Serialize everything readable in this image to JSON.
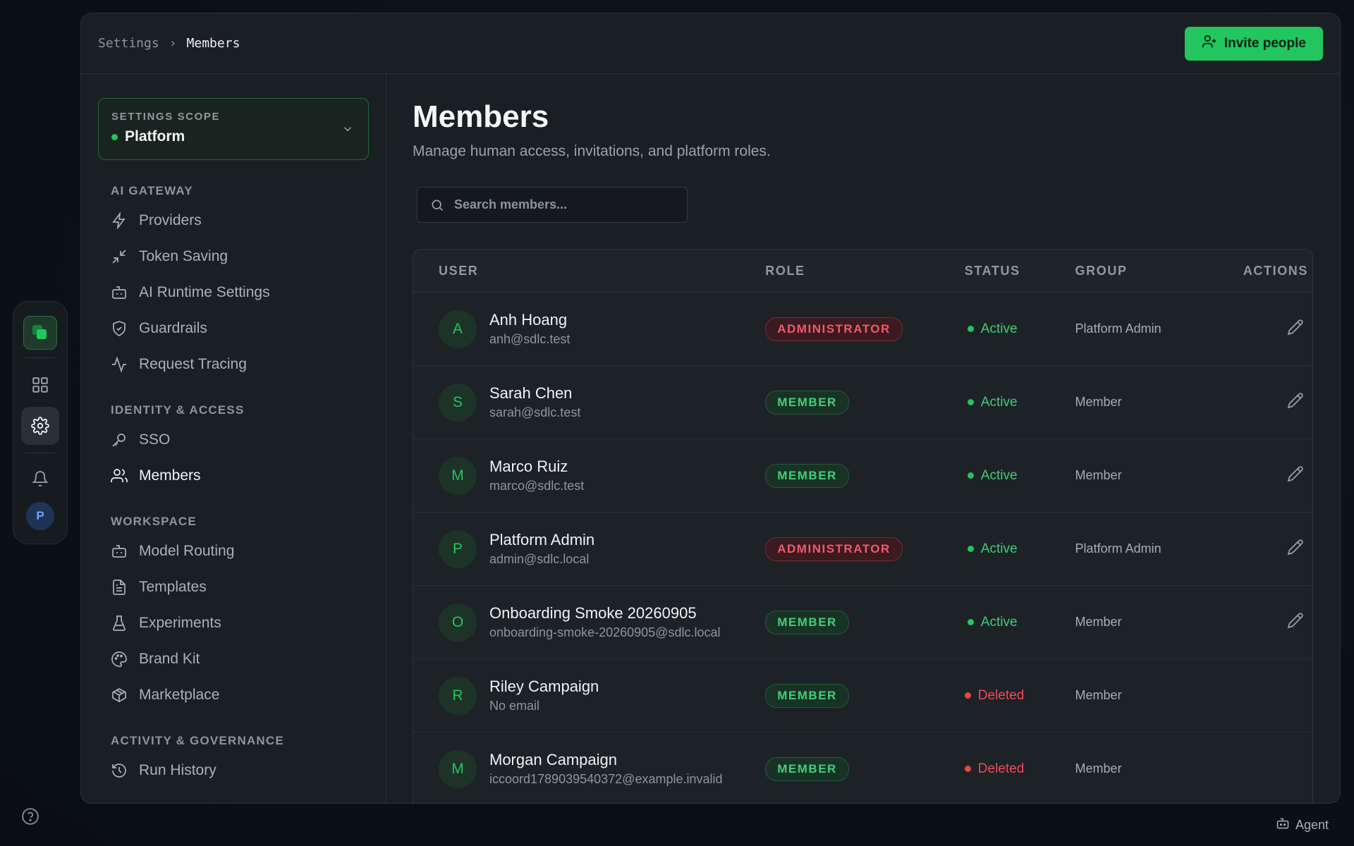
{
  "breadcrumb": {
    "parent": "Settings",
    "separator": "›",
    "current": "Members"
  },
  "header": {
    "invite_label": "Invite people"
  },
  "scope": {
    "label": "SETTINGS SCOPE",
    "value": "Platform"
  },
  "nav": {
    "ai_gateway": {
      "title": "AI GATEWAY",
      "items": [
        {
          "label": "Providers",
          "icon": "zap-icon"
        },
        {
          "label": "Token Saving",
          "icon": "minimize-icon"
        },
        {
          "label": "AI Runtime Settings",
          "icon": "bot-icon"
        },
        {
          "label": "Guardrails",
          "icon": "shield-icon"
        },
        {
          "label": "Request Tracing",
          "icon": "activity-icon"
        }
      ]
    },
    "identity": {
      "title": "IDENTITY & ACCESS",
      "items": [
        {
          "label": "SSO",
          "icon": "key-icon"
        },
        {
          "label": "Members",
          "icon": "users-icon"
        }
      ]
    },
    "workspace": {
      "title": "WORKSPACE",
      "items": [
        {
          "label": "Model Routing",
          "icon": "bot-icon"
        },
        {
          "label": "Templates",
          "icon": "file-icon"
        },
        {
          "label": "Experiments",
          "icon": "flask-icon"
        },
        {
          "label": "Brand Kit",
          "icon": "palette-icon"
        },
        {
          "label": "Marketplace",
          "icon": "package-icon"
        }
      ]
    },
    "activity": {
      "title": "ACTIVITY & GOVERNANCE",
      "items": [
        {
          "label": "Run History",
          "icon": "history-icon"
        }
      ]
    }
  },
  "main": {
    "title": "Members",
    "subtitle": "Manage human access, invitations, and platform roles.",
    "search_placeholder": "Search members..."
  },
  "table": {
    "columns": {
      "user": "USER",
      "role": "ROLE",
      "status": "STATUS",
      "group": "GROUP",
      "actions": "ACTIONS"
    },
    "rows": [
      {
        "initial": "A",
        "name": "Anh Hoang",
        "email": "anh@sdlc.test",
        "role": "ADMINISTRATOR",
        "status": "Active",
        "group": "Platform Admin"
      },
      {
        "initial": "S",
        "name": "Sarah Chen",
        "email": "sarah@sdlc.test",
        "role": "MEMBER",
        "status": "Active",
        "group": "Member"
      },
      {
        "initial": "M",
        "name": "Marco Ruiz",
        "email": "marco@sdlc.test",
        "role": "MEMBER",
        "status": "Active",
        "group": "Member"
      },
      {
        "initial": "P",
        "name": "Platform Admin",
        "email": "admin@sdlc.local",
        "role": "ADMINISTRATOR",
        "status": "Active",
        "group": "Platform Admin"
      },
      {
        "initial": "O",
        "name": "Onboarding Smoke 20260905",
        "email": "onboarding-smoke-20260905@sdlc.local",
        "role": "MEMBER",
        "status": "Active",
        "group": "Member"
      },
      {
        "initial": "R",
        "name": "Riley Campaign",
        "email": "No email",
        "role": "MEMBER",
        "status": "Deleted",
        "group": "Member"
      },
      {
        "initial": "M",
        "name": "Morgan Campaign",
        "email": "iccoord1789039540372@example.invalid",
        "role": "MEMBER",
        "status": "Deleted",
        "group": "Member"
      }
    ]
  },
  "rail": {
    "avatar_initial": "P"
  },
  "footer": {
    "agent_label": "Agent"
  },
  "colors": {
    "accent": "#22c55e",
    "danger": "#ef4444",
    "background": "#0c1219",
    "panel": "#1a1f24"
  }
}
